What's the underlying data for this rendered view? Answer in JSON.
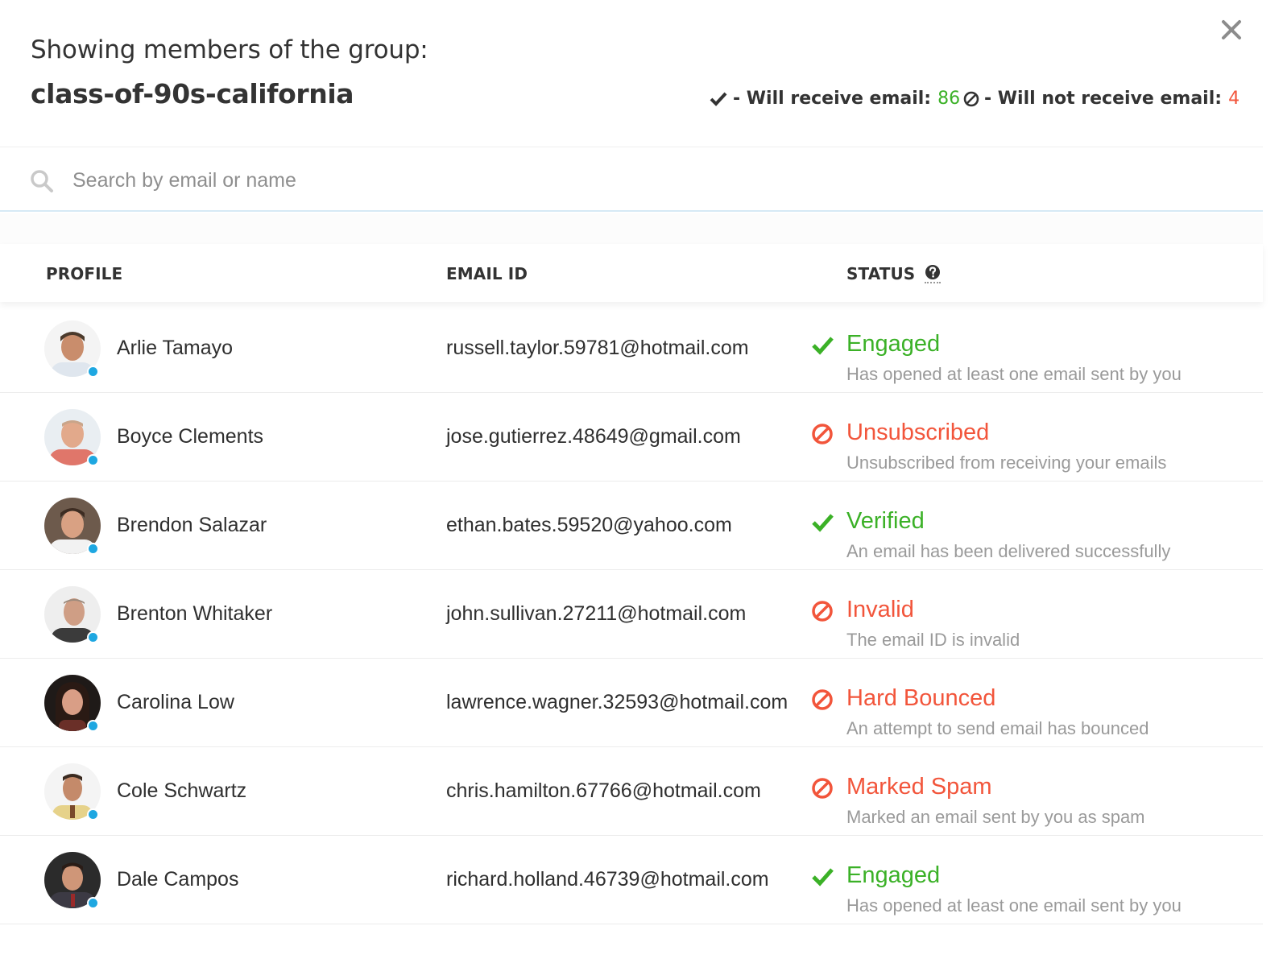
{
  "header": {
    "title_line": "Showing members of the group:",
    "group_name": "class-of-90s-california",
    "will_receive_label": "- Will receive email:",
    "will_receive_count": "86",
    "will_not_receive_label": "- Will not receive email:",
    "will_not_receive_count": "4"
  },
  "search": {
    "placeholder": "Search by email or name",
    "value": ""
  },
  "table": {
    "columns": {
      "profile": "PROFILE",
      "email": "EMAIL ID",
      "status": "STATUS"
    },
    "rows": [
      {
        "name": "Arlie Tamayo",
        "email": "russell.taylor.59781@hotmail.com",
        "status": "Engaged",
        "description": "Has opened at least one email sent by you",
        "positive": true
      },
      {
        "name": "Boyce Clements",
        "email": "jose.gutierrez.48649@gmail.com",
        "status": "Unsubscribed",
        "description": "Unsubscribed from receiving your emails",
        "positive": false
      },
      {
        "name": "Brendon Salazar",
        "email": "ethan.bates.59520@yahoo.com",
        "status": "Verified",
        "description": "An email has been delivered successfully",
        "positive": true
      },
      {
        "name": "Brenton Whitaker",
        "email": "john.sullivan.27211@hotmail.com",
        "status": "Invalid",
        "description": "The email ID is invalid",
        "positive": false
      },
      {
        "name": "Carolina Low",
        "email": "lawrence.wagner.32593@hotmail.com",
        "status": "Hard Bounced",
        "description": "An attempt to send email has bounced",
        "positive": false
      },
      {
        "name": "Cole Schwartz",
        "email": "chris.hamilton.67766@hotmail.com",
        "status": "Marked Spam",
        "description": "Marked an email sent by you as spam",
        "positive": false
      },
      {
        "name": "Dale Campos",
        "email": "richard.holland.46739@hotmail.com",
        "status": "Engaged",
        "description": "Has opened at least one email sent by you",
        "positive": true
      }
    ]
  },
  "colors": {
    "positive": "#3bb127",
    "negative": "#f2553b",
    "online_dot": "#1ea7e1"
  },
  "icons": {
    "close": "close-icon",
    "search": "search-icon",
    "check": "check-icon",
    "blocked": "blocked-icon",
    "help": "help-icon"
  }
}
